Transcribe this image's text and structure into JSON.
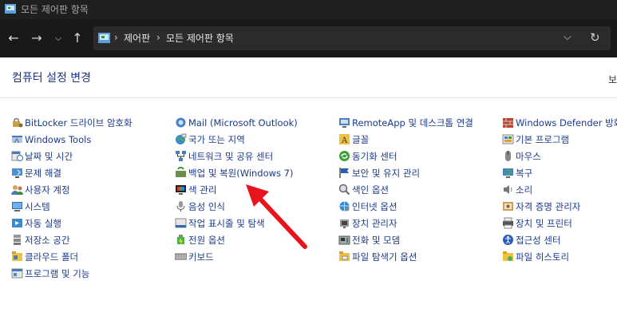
{
  "window": {
    "title": "모든 제어판 항목"
  },
  "breadcrumb": {
    "root": "제어판",
    "current": "모든 제어판 항목"
  },
  "header": {
    "title": "컴퓨터 설정 변경",
    "view_cut": "보"
  },
  "columns": [
    [
      {
        "label": "BitLocker 드라이브 암호화",
        "icon": "bitlocker-icon"
      },
      {
        "label": "Windows Tools",
        "icon": "windows-tools-icon"
      },
      {
        "label": "날짜 및 시간",
        "icon": "datetime-icon"
      },
      {
        "label": "문제 해결",
        "icon": "troubleshoot-icon"
      },
      {
        "label": "사용자 계정",
        "icon": "user-accounts-icon"
      },
      {
        "label": "시스템",
        "icon": "system-icon"
      },
      {
        "label": "자동 실행",
        "icon": "autoplay-icon"
      },
      {
        "label": "저장소 공간",
        "icon": "storage-icon"
      },
      {
        "label": "클라우드 폴더",
        "icon": "cloud-folder-icon"
      },
      {
        "label": "프로그램 및 기능",
        "icon": "programs-icon"
      }
    ],
    [
      {
        "label": "Mail (Microsoft Outlook)",
        "icon": "mail-icon"
      },
      {
        "label": "국가 또는 지역",
        "icon": "region-icon"
      },
      {
        "label": "네트워크 및 공유 센터",
        "icon": "network-icon"
      },
      {
        "label": "백업 및 복원(Windows 7)",
        "icon": "backup-icon"
      },
      {
        "label": "색 관리",
        "icon": "color-management-icon"
      },
      {
        "label": "음성 인식",
        "icon": "speech-icon"
      },
      {
        "label": "작업 표시줄 및 탐색",
        "icon": "taskbar-icon"
      },
      {
        "label": "전원 옵션",
        "icon": "power-icon"
      },
      {
        "label": "키보드",
        "icon": "keyboard-icon"
      }
    ],
    [
      {
        "label": "RemoteApp 및 데스크톱 연결",
        "icon": "remoteapp-icon"
      },
      {
        "label": "글꼴",
        "icon": "fonts-icon"
      },
      {
        "label": "동기화 센터",
        "icon": "sync-icon"
      },
      {
        "label": "보안 및 유지 관리",
        "icon": "security-flag-icon"
      },
      {
        "label": "색인 옵션",
        "icon": "indexing-icon"
      },
      {
        "label": "인터넷 옵션",
        "icon": "internet-options-icon"
      },
      {
        "label": "장치 관리자",
        "icon": "device-manager-icon"
      },
      {
        "label": "전화 및 모뎀",
        "icon": "phone-modem-icon"
      },
      {
        "label": "파일 탐색기 옵션",
        "icon": "explorer-options-icon"
      }
    ],
    [
      {
        "label": "Windows Defender 방화벽",
        "icon": "firewall-icon"
      },
      {
        "label": "기본 프로그램",
        "icon": "default-programs-icon"
      },
      {
        "label": "마우스",
        "icon": "mouse-icon"
      },
      {
        "label": "복구",
        "icon": "recovery-icon"
      },
      {
        "label": "소리",
        "icon": "sound-icon"
      },
      {
        "label": "자격 증명 관리자",
        "icon": "credential-icon"
      },
      {
        "label": "장치 및 프린터",
        "icon": "printer-icon"
      },
      {
        "label": "접근성 센터",
        "icon": "accessibility-icon"
      },
      {
        "label": "파일 히스토리",
        "icon": "file-history-icon"
      }
    ]
  ],
  "colors": {
    "link": "#1a3a8a",
    "heading": "#1e3287",
    "arrow": "#e8141c"
  }
}
